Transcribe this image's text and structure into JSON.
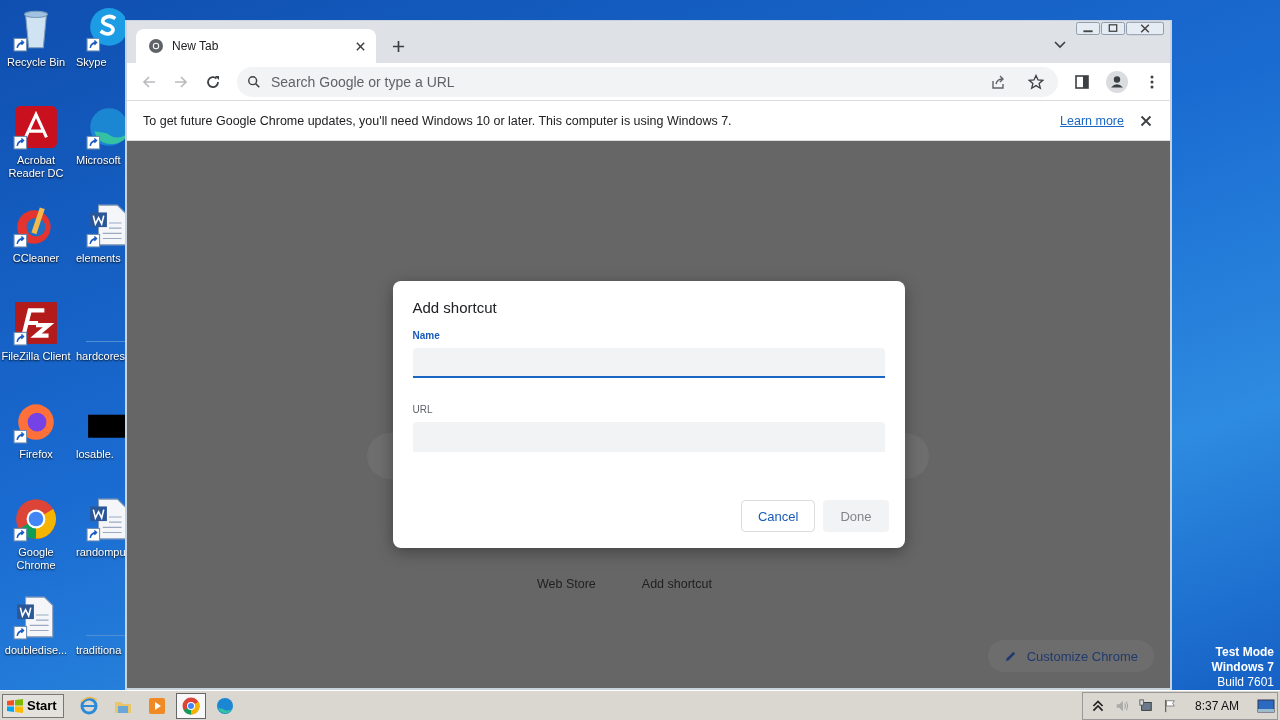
{
  "desktop": {
    "columns": [
      [
        {
          "label": "Recycle Bin",
          "kind": "recycle"
        },
        {
          "label": "Acrobat Reader DC",
          "kind": "acrobat"
        },
        {
          "label": "CCleaner",
          "kind": "ccleaner"
        },
        {
          "label": "FileZilla Client",
          "kind": "filezilla"
        },
        {
          "label": "Firefox",
          "kind": "firefox"
        },
        {
          "label": "Google Chrome",
          "kind": "chrome"
        },
        {
          "label": "doubledise...",
          "kind": "word"
        }
      ],
      [
        {
          "label": "Skype",
          "kind": "skype"
        },
        {
          "label": "Microsoft",
          "kind": "edge"
        },
        {
          "label": "elements",
          "kind": "word"
        },
        {
          "label": "hardcores",
          "kind": "blank"
        },
        {
          "label": "losable.",
          "kind": "black"
        },
        {
          "label": "randompu",
          "kind": "word"
        },
        {
          "label": "traditiona",
          "kind": "blank"
        }
      ]
    ],
    "test_mode": [
      "Test Mode",
      "Windows 7",
      "Build 7601"
    ]
  },
  "browser": {
    "tabs": [
      {
        "title": "New Tab",
        "selected": true
      }
    ],
    "navigation": {
      "back_enabled": false,
      "forward_enabled": false
    },
    "address_bar": {
      "placeholder": "Search Google or type a URL"
    },
    "infobar": {
      "message": "To get future Google Chrome updates, you'll need Windows 10 or later. This computer is using Windows 7.",
      "link": "Learn more"
    },
    "page": {
      "shortcuts": [
        {
          "label": "Web Store"
        },
        {
          "label": "Add shortcut"
        }
      ],
      "customize_button": "Customize Chrome"
    },
    "dialog": {
      "title": "Add shortcut",
      "fields": [
        {
          "label": "Name",
          "focused": true
        },
        {
          "label": "URL",
          "focused": false
        }
      ],
      "buttons": [
        {
          "label": "Cancel",
          "disabled": false
        },
        {
          "label": "Done",
          "disabled": true
        }
      ]
    }
  },
  "taskbar": {
    "start": "Start",
    "apps": [
      {
        "kind": "ie",
        "selected": false
      },
      {
        "kind": "explorer",
        "selected": false
      },
      {
        "kind": "media",
        "selected": false
      },
      {
        "kind": "chrome",
        "selected": true
      },
      {
        "kind": "edge",
        "selected": false
      }
    ],
    "clock": "8:37 AM"
  }
}
